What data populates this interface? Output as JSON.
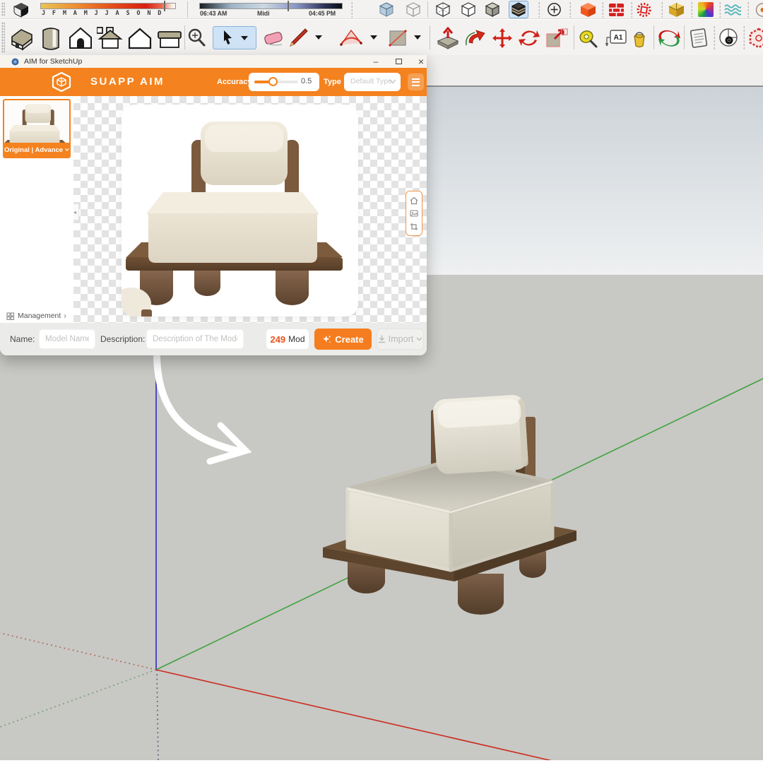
{
  "colors": {
    "accent": "#f4821e",
    "accent_light": "#f5a055",
    "create_button": "#f57d1f",
    "mod_number": "#e8541e",
    "axis_red": "#cc2b1e",
    "axis_green": "#3fa33f",
    "axis_blue": "#2a2acd",
    "viewport_ground": "#c8c8c4",
    "viewport_sky_top": "#ccd2d7"
  },
  "toolbar": {
    "months": "J F M A M J J A S O N D",
    "time_start": "06:43 AM",
    "time_mid": "Midi",
    "time_end": "04:45 PM",
    "a1_label": "A1"
  },
  "dialog": {
    "window_title": "AIM for SketchUp",
    "brand": "SUAPP AIM",
    "accuracy_label": "Accuracy",
    "accuracy_value": "0.5",
    "type_label": "Type",
    "type_value": "Default Type",
    "thumb_label": "Original | Advance",
    "management": "Management",
    "name_label": "Name:",
    "name_placeholder": "Model Name",
    "desc_label": "Description:",
    "desc_placeholder": "Description of The Model",
    "mod_count": "249",
    "mod_unit": "Mod",
    "create_label": "Create",
    "import_label": "Import"
  },
  "icons": {
    "minimize": "–",
    "close": "×",
    "management_chevron": "›",
    "collapse_arrow": "◂",
    "note": "icon glyphs rendered as inline SVG / CSS shapes: shadow-cube, style-cubes, plus-circle, orange-cube, brick-wall, dotted-gear, yellow-cube, rainbow-swatch, waves, house-set, zoom, select-cursor, eraser, pencil, arc, rectangle, push-pull, follow-me, move, rotate, scale, tape-measure, text-a1, paint-bucket, orbit, notepad, camera-circle, hexagon, home, image, crop, sparkle, import-arrow, chevron-down, hamburger"
  }
}
